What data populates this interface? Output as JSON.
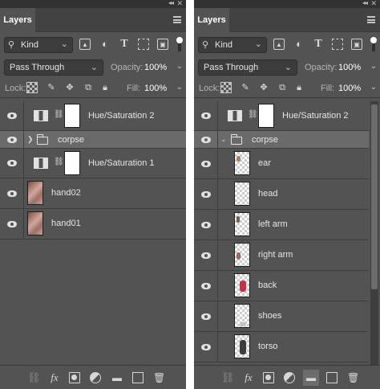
{
  "panels": [
    {
      "id": "left",
      "tab_label": "Layers",
      "kind_label": "Kind",
      "blend_mode": "Pass Through",
      "opacity_label": "Opacity:",
      "opacity_value": "100%",
      "lock_label": "Lock:",
      "fill_label": "Fill:",
      "fill_value": "100%",
      "layers": [
        {
          "type": "adjustment",
          "name": "Hue/Saturation 2",
          "icon": "hue-saturation-icon"
        },
        {
          "type": "group",
          "name": "corpse",
          "expanded": false,
          "selected": true,
          "icon": "folder-icon"
        },
        {
          "type": "adjustment",
          "name": "Hue/Saturation 1",
          "icon": "hue-saturation-icon"
        },
        {
          "type": "pixel",
          "name": "hand02",
          "icon": "photo-thumbnail"
        },
        {
          "type": "pixel",
          "name": "hand01",
          "icon": "photo-thumbnail"
        }
      ]
    },
    {
      "id": "right",
      "tab_label": "Layers",
      "kind_label": "Kind",
      "blend_mode": "Pass Through",
      "opacity_label": "Opacity:",
      "opacity_value": "100%",
      "lock_label": "Lock:",
      "fill_label": "Fill:",
      "fill_value": "100%",
      "layers": [
        {
          "type": "adjustment",
          "name": "Hue/Saturation 2",
          "icon": "hue-saturation-icon"
        },
        {
          "type": "group",
          "name": "corpse",
          "expanded": true,
          "selected": true,
          "icon": "folder-icon"
        },
        {
          "type": "pixel",
          "name": "ear",
          "indent": true,
          "color": "#b27a64"
        },
        {
          "type": "pixel",
          "name": "head",
          "indent": true,
          "color": "#c9bdb4"
        },
        {
          "type": "pixel",
          "name": "left arm",
          "indent": true,
          "color": "#7c5a4c"
        },
        {
          "type": "pixel",
          "name": "right arm",
          "indent": true,
          "color": "#9c6a58"
        },
        {
          "type": "pixel",
          "name": "back",
          "indent": true,
          "color": "#c0344a"
        },
        {
          "type": "pixel",
          "name": "shoes",
          "indent": true,
          "color": "#b8c4cc"
        },
        {
          "type": "pixel",
          "name": "torso",
          "indent": true,
          "color": "#3c3c44"
        }
      ]
    }
  ],
  "icons": {
    "topbar": [
      "collapse-icon",
      "close-icon",
      "panel-menu-icon"
    ],
    "filters": [
      "pixel-filter-icon",
      "adjustment-filter-icon",
      "type-filter-icon",
      "shape-filter-icon",
      "smart-object-filter-icon",
      "filter-toggle"
    ],
    "locks": [
      "lock-transparent-icon",
      "lock-image-icon",
      "lock-position-icon",
      "lock-artboard-icon",
      "lock-all-icon"
    ],
    "bottom": [
      "link-layers-icon",
      "fx-icon",
      "add-mask-icon",
      "new-adjustment-icon",
      "new-group-icon",
      "new-layer-icon",
      "trash-icon"
    ]
  }
}
